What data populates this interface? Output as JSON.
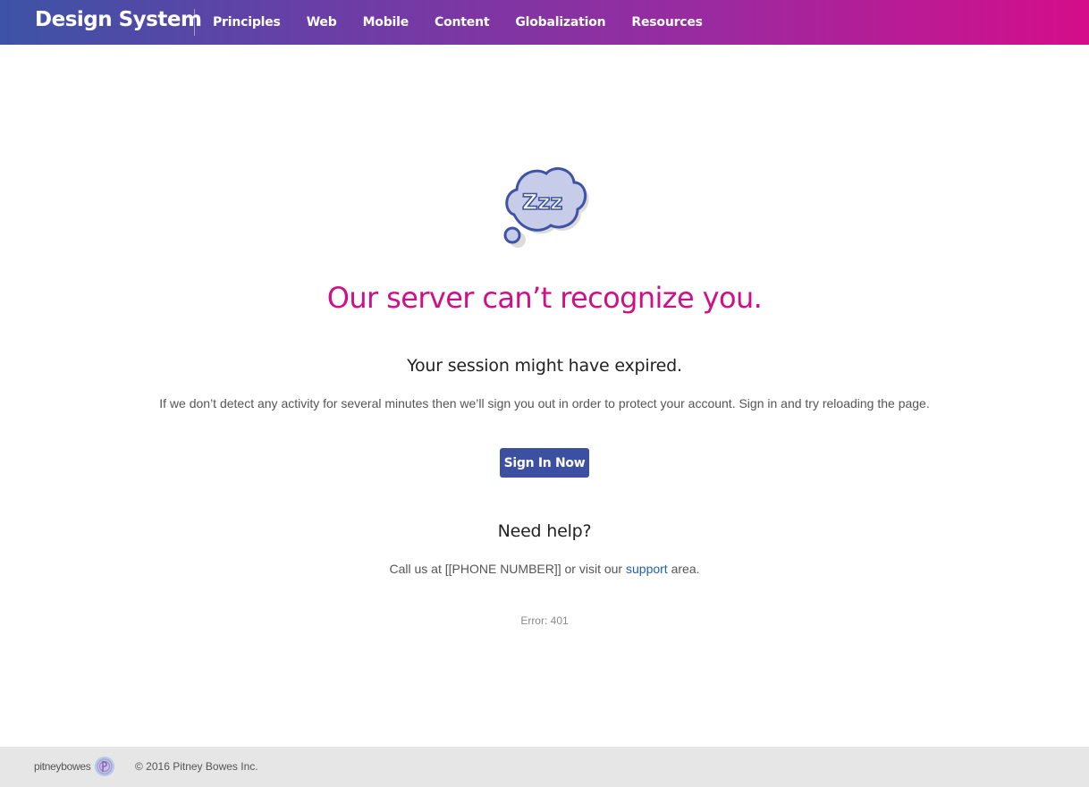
{
  "header": {
    "brand": "Design System",
    "nav": [
      "Principles",
      "Web",
      "Mobile",
      "Content",
      "Globalization",
      "Resources"
    ]
  },
  "main": {
    "illustration_icon": "sleeping-cloud-zzz-icon",
    "illustration_text": "Zzz",
    "headline": "Our server can’t recognize you.",
    "subhead": "Your session might have expired.",
    "body": "If we don’t detect any activity for several minutes then we’ll sign you out in order to protect your account. Sign in and try reloading the page.",
    "signin_label": "Sign In Now",
    "help_title": "Need help?",
    "help_prefix": "Call us at [[PHONE NUMBER]] or visit our ",
    "help_link": "support",
    "help_suffix": " area.",
    "error": "Error: 401"
  },
  "footer": {
    "logo_text": "pitneybowes",
    "copyright": "© 2016 Pitney Bowes Inc."
  },
  "colors": {
    "gradient_start": "#3c53a6",
    "gradient_end": "#d50d8a",
    "headline": "#cf0f88",
    "button": "#3c4fa0",
    "link": "#1f5fb5"
  }
}
